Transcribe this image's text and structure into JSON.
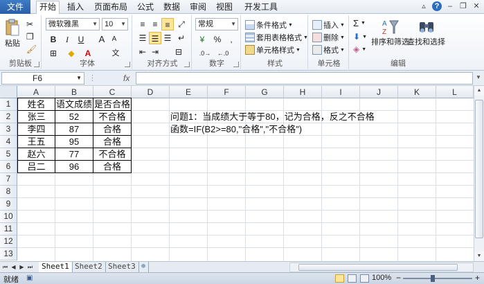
{
  "tabs": {
    "file": "文件",
    "items": [
      "开始",
      "插入",
      "页面布局",
      "公式",
      "数据",
      "审阅",
      "视图",
      "开发工具"
    ],
    "active": "开始"
  },
  "ribbon": {
    "clipboard": {
      "label": "剪贴板",
      "paste": "粘贴"
    },
    "font": {
      "label": "字体",
      "name": "微软雅黑",
      "size": "10",
      "bold": "B",
      "italic": "I",
      "underline": "U",
      "grow": "A",
      "shrink": "A",
      "phonetic": "文"
    },
    "alignment": {
      "label": "对齐方式"
    },
    "number": {
      "label": "数字",
      "format": "常规",
      "percent": "%",
      "comma": ","
    },
    "styles": {
      "label": "样式",
      "conditional": "条件格式",
      "table": "套用表格格式",
      "cell": "单元格样式"
    },
    "cells": {
      "label": "单元格",
      "insert": "插入",
      "delete": "删除",
      "format": "格式"
    },
    "editing": {
      "label": "编辑",
      "sum": "Σ",
      "sort": "排序和筛选",
      "find": "查找和选择"
    }
  },
  "formula_bar": {
    "name_box": "F6",
    "fx": "fx",
    "formula": ""
  },
  "columns": [
    "A",
    "B",
    "C",
    "D",
    "E",
    "F",
    "G",
    "H",
    "I",
    "J",
    "K",
    "L"
  ],
  "rows": [
    "1",
    "2",
    "3",
    "4",
    "5",
    "6",
    "7",
    "8",
    "9",
    "10",
    "11",
    "12",
    "13"
  ],
  "table": {
    "headers": [
      "姓名",
      "语文成绩",
      "是否合格"
    ],
    "rows": [
      [
        "张三",
        "52",
        "不合格"
      ],
      [
        "李四",
        "87",
        "合格"
      ],
      [
        "王五",
        "95",
        "合格"
      ],
      [
        "赵六",
        "77",
        "不合格"
      ],
      [
        "吕二",
        "96",
        "合格"
      ]
    ]
  },
  "notes": {
    "line1": "问题1：当成绩大于等于80，记为合格，反之不合格",
    "line2": "函数=IF(B2>=80,\"合格\",\"不合格\")"
  },
  "sheets": [
    "Sheet1",
    "Sheet2",
    "Sheet3"
  ],
  "active_sheet": "Sheet1",
  "status": {
    "mode": "就绪",
    "zoom": "100%"
  }
}
